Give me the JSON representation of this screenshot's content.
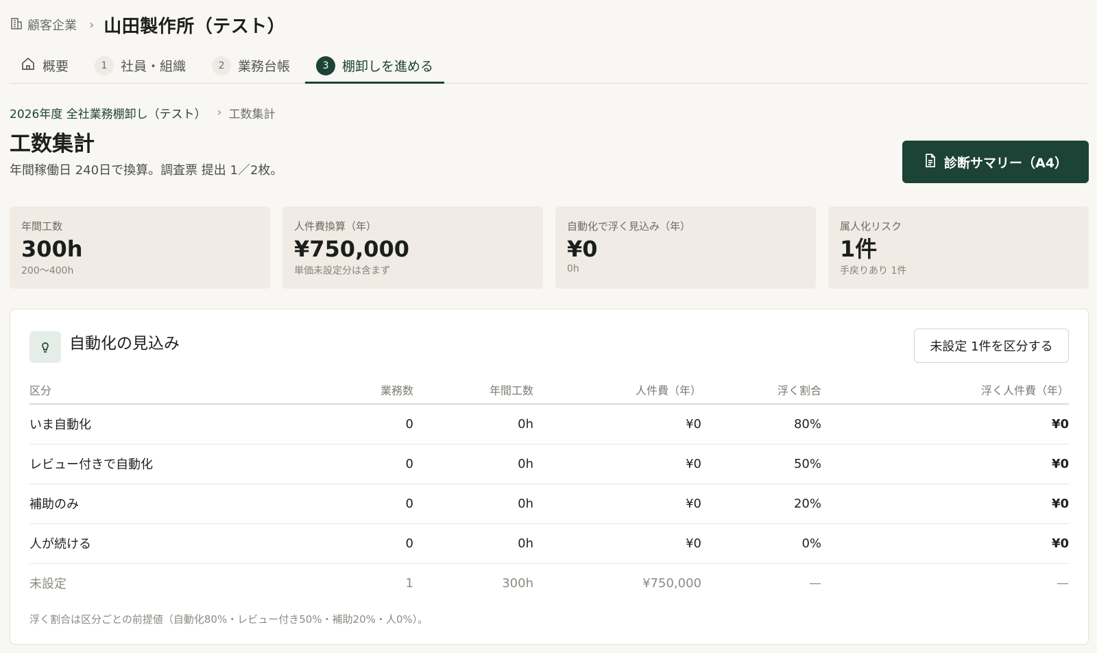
{
  "header": {
    "company_crumb": "顧客企業",
    "company_name": "山田製作所（テスト）"
  },
  "tabs": [
    {
      "label": "概要",
      "num": ""
    },
    {
      "label": "社員・組織",
      "num": "1"
    },
    {
      "label": "業務台帳",
      "num": "2"
    },
    {
      "label": "棚卸しを進める",
      "num": "3"
    }
  ],
  "breadcrumb": {
    "parent": "2026年度 全社業務棚卸し（テスト）",
    "current": "工数集計"
  },
  "page": {
    "title": "工数集計",
    "description": "年間稼働日 240日で換算。調査票 提出 1／2枚。",
    "summary_button": "診断サマリー（A4）"
  },
  "stats": [
    {
      "label": "年間工数",
      "value": "300h",
      "sub": "200〜400h"
    },
    {
      "label": "人件費換算（年）",
      "value": "¥750,000",
      "sub": "単価未設定分は含まず"
    },
    {
      "label": "自動化で浮く見込み（年）",
      "value": "¥0",
      "sub": "0h"
    },
    {
      "label": "属人化リスク",
      "value": "1件",
      "sub": "手戻りあり 1件"
    }
  ],
  "automation": {
    "title": "自動化の見込み",
    "classify_button": "未設定 1件を区分する",
    "columns": [
      "区分",
      "業務数",
      "年間工数",
      "人件費（年）",
      "浮く割合",
      "浮く人件費（年）"
    ],
    "rows": [
      {
        "category": "いま自動化",
        "tasks": "0",
        "hours": "0h",
        "cost": "¥0",
        "ratio": "80%",
        "saved": "¥0"
      },
      {
        "category": "レビュー付きで自動化",
        "tasks": "0",
        "hours": "0h",
        "cost": "¥0",
        "ratio": "50%",
        "saved": "¥0"
      },
      {
        "category": "補助のみ",
        "tasks": "0",
        "hours": "0h",
        "cost": "¥0",
        "ratio": "20%",
        "saved": "¥0"
      },
      {
        "category": "人が続ける",
        "tasks": "0",
        "hours": "0h",
        "cost": "¥0",
        "ratio": "0%",
        "saved": "¥0"
      },
      {
        "category": "未設定",
        "tasks": "1",
        "hours": "300h",
        "cost": "¥750,000",
        "ratio": "—",
        "saved": "—"
      }
    ],
    "footnote": "浮く割合は区分ごとの前提値（自動化80%・レビュー付き50%・補助20%・人0%）。"
  }
}
